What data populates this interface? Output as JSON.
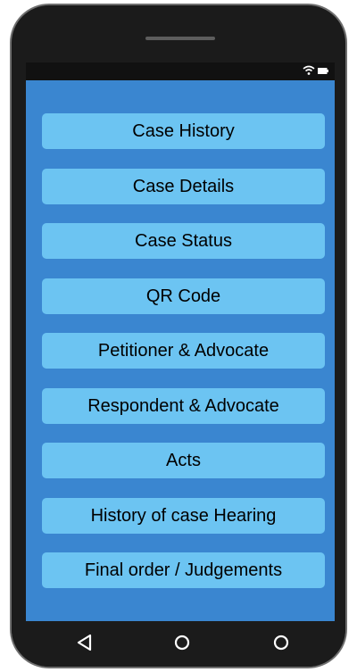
{
  "menu": {
    "items": [
      {
        "label": "Case History"
      },
      {
        "label": "Case Details"
      },
      {
        "label": "Case Status"
      },
      {
        "label": "QR Code"
      },
      {
        "label": "Petitioner & Advocate"
      },
      {
        "label": "Respondent & Advocate"
      },
      {
        "label": "Acts"
      },
      {
        "label": "History of case Hearing"
      },
      {
        "label": "Final order / Judgements"
      }
    ]
  },
  "colors": {
    "background": "#3a86d0",
    "button": "#6cc4f2",
    "device": "#1b1b1b"
  },
  "icons": {
    "status": [
      "wifi-icon",
      "battery-icon"
    ],
    "navigation": [
      "back-triangle-icon",
      "home-circle-icon",
      "recents-circle-icon"
    ]
  }
}
